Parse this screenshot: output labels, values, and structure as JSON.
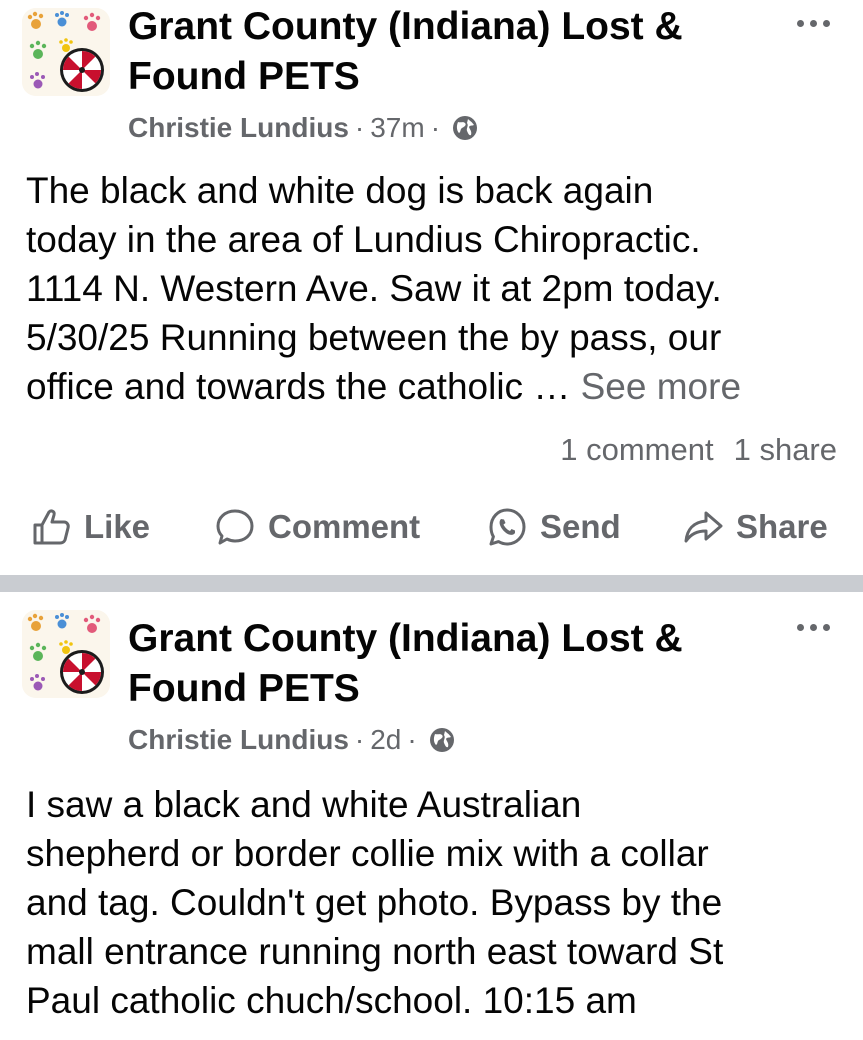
{
  "posts": [
    {
      "group_name": "Grant County (Indiana) Lost & Found PETS",
      "author": "Christie Lundius",
      "time": "37m",
      "privacy_icon": "globe-icon",
      "text_lines": [
        "The black and white dog is back again",
        "today in the area of Lundius Chiropractic.",
        "1114 N. Western Ave.  Saw it at 2pm today.",
        "5/30/25  Running between the by pass, our",
        "office and towards the catholic … "
      ],
      "see_more": "See more",
      "comments": "1 comment",
      "shares": "1 share",
      "actions": {
        "like": "Like",
        "comment": "Comment",
        "send": "Send",
        "share": "Share"
      }
    },
    {
      "group_name": "Grant County (Indiana) Lost & Found PETS",
      "author": "Christie Lundius",
      "time": "2d",
      "privacy_icon": "globe-icon",
      "text_lines": [
        "I saw a black and white Australian",
        "shepherd or border collie mix with a collar",
        "and tag.  Couldn't get photo.  Bypass by the",
        "mall entrance running north east toward St",
        "Paul catholic chuch/school. 10:15 am"
      ]
    }
  ],
  "colors": {
    "text_primary": "#050505",
    "text_secondary": "#65676b",
    "separator": "#c9ccd1",
    "avatar_badge": "#c8102e"
  }
}
